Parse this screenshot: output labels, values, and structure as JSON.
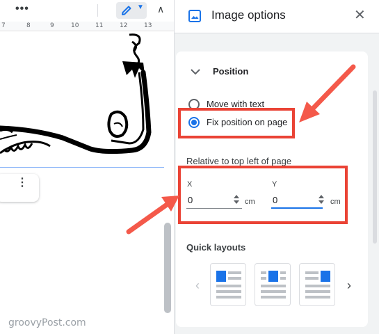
{
  "toolbar": {
    "more_glyph": "•••",
    "collapse_glyph": "∧",
    "edit_caret": "▼"
  },
  "ruler": {
    "ticks": [
      "7",
      "8",
      "9",
      "10",
      "11",
      "12",
      "13"
    ]
  },
  "image_menu": {
    "more_glyph": "⋮"
  },
  "panel": {
    "title": "Image options",
    "close_glyph": "✕",
    "header_icon": "image-icon"
  },
  "position_section": {
    "title": "Position",
    "options": [
      {
        "label": "Move with text",
        "selected": false
      },
      {
        "label": "Fix position on page",
        "selected": true
      }
    ],
    "relative_label": "Relative to top left of page",
    "x": {
      "label": "X",
      "value": "0",
      "unit": "cm"
    },
    "y": {
      "label": "Y",
      "value": "0",
      "unit": "cm"
    }
  },
  "quick_layouts": {
    "title": "Quick layouts",
    "prev_glyph": "‹",
    "next_glyph": "›",
    "layouts": [
      "top-left-image-layout",
      "top-center-image-layout",
      "top-right-image-layout"
    ]
  },
  "watermark": "groovyPost.com",
  "colors": {
    "accent": "#1a73e8",
    "highlight": "#ea4335",
    "arrow": "#f4594a",
    "panel_bg": "#f1f3f4"
  }
}
